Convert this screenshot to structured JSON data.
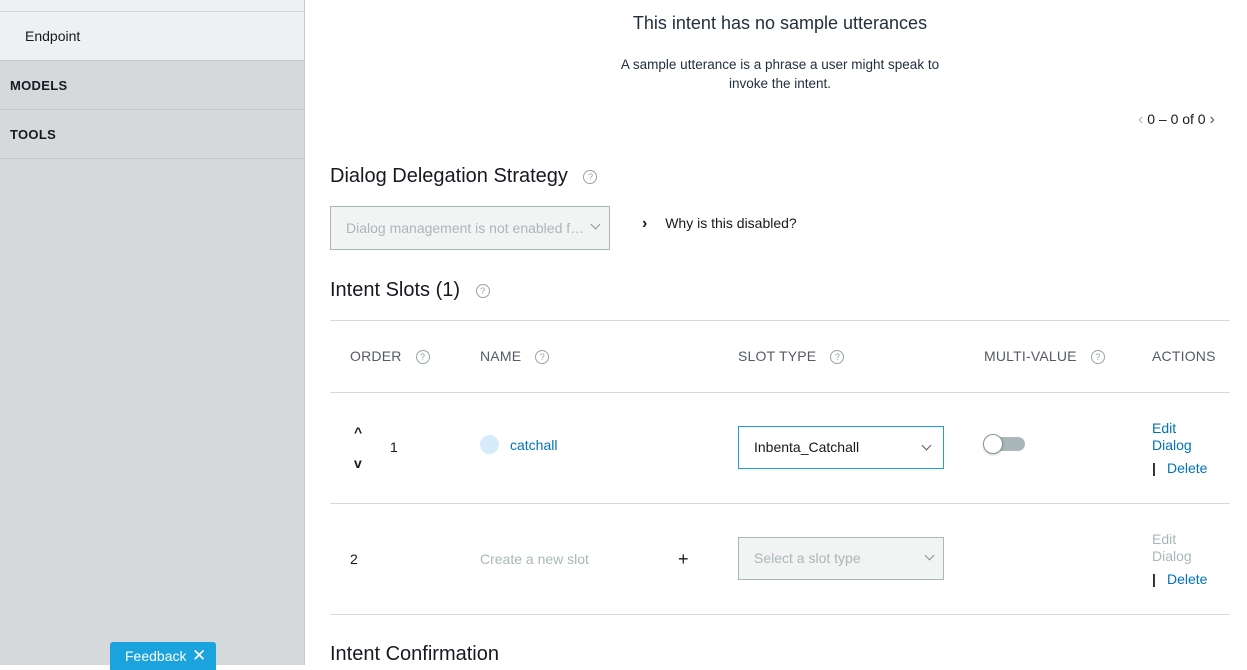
{
  "sidebar": {
    "endpoint_label": "Endpoint",
    "sections": [
      "MODELS",
      "TOOLS"
    ],
    "feedback_label": "Feedback",
    "feedback_close": "✕"
  },
  "utterances": {
    "empty_title": "This intent has no sample utterances",
    "empty_desc_line1": "A sample utterance is a phrase a user might speak to",
    "empty_desc_line2": "invoke the intent.",
    "pager_prev": "‹",
    "pager_text": "0 – 0 of 0",
    "pager_next": "›"
  },
  "dialog_delegation": {
    "title": "Dialog Delegation Strategy",
    "help": "?",
    "select_value": "Dialog management is not enabled f…",
    "why_chevron": "›",
    "why_label": "Why is this disabled?"
  },
  "intent_slots": {
    "title": "Intent Slots (1)",
    "help": "?",
    "columns": [
      "ORDER",
      "NAME",
      "SLOT TYPE",
      "MULTI-VALUE",
      "ACTIONS"
    ],
    "column_help": "?",
    "rows": [
      {
        "order": "1",
        "up_arrow": "^",
        "down_arrow": "v",
        "name": "catchall",
        "slot_type": "Inbenta_Catchall",
        "multi_value": false,
        "edit_line1": "Edit",
        "edit_line2": "Dialog",
        "sep": "|",
        "delete": "Delete"
      },
      {
        "order": "2",
        "name_placeholder": "Create a new slot",
        "add_symbol": "+",
        "slot_type_placeholder": "Select a slot type",
        "edit_line1": "Edit",
        "edit_line2": "Dialog",
        "sep": "|",
        "delete": "Delete"
      }
    ]
  },
  "intent_confirmation": {
    "title": "Intent Confirmation"
  }
}
